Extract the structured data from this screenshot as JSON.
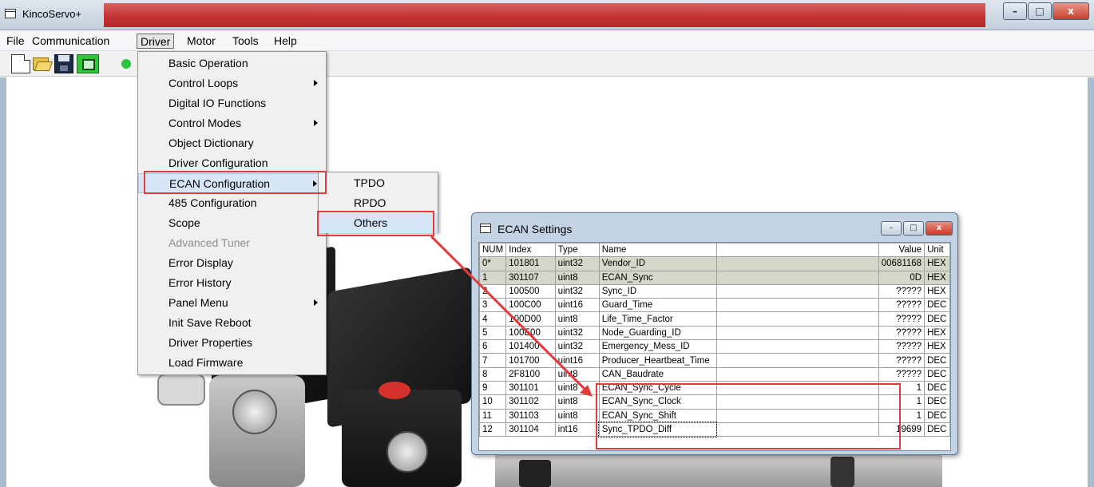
{
  "window": {
    "title": "KincoServo+"
  },
  "menubar": [
    "File",
    "Communication",
    "Driver",
    "Motor",
    "Tools",
    "Help"
  ],
  "driver_menu": [
    {
      "label": "Basic Operation"
    },
    {
      "label": "Control Loops",
      "submenu": true
    },
    {
      "label": "Digital IO Functions"
    },
    {
      "label": "Control Modes",
      "submenu": true
    },
    {
      "label": "Object Dictionary"
    },
    {
      "label": "Driver Configuration"
    },
    {
      "label": "ECAN Configuration",
      "submenu": true
    },
    {
      "label": "485 Configuration"
    },
    {
      "label": "Scope"
    },
    {
      "label": "Advanced Tuner",
      "disabled": true
    },
    {
      "label": "Error Display"
    },
    {
      "label": "Error History"
    },
    {
      "label": "Panel Menu",
      "submenu": true
    },
    {
      "label": "Init Save Reboot"
    },
    {
      "label": "Driver Properties"
    },
    {
      "label": "Load Firmware"
    }
  ],
  "ecan_submenu": [
    "TPDO",
    "RPDO",
    "Others"
  ],
  "dialog": {
    "title": "ECAN Settings",
    "columns": [
      "NUM",
      "Index",
      "Type",
      "Name",
      "",
      "Value",
      "Unit"
    ],
    "rows": [
      {
        "num": "0*",
        "index": "101801",
        "type": "uint32",
        "name": "Vendor_ID",
        "value": "00681168",
        "unit": "HEX"
      },
      {
        "num": "1",
        "index": "301107",
        "type": "uint8",
        "name": "ECAN_Sync",
        "value": "0D",
        "unit": "HEX"
      },
      {
        "num": "2",
        "index": "100500",
        "type": "uint32",
        "name": "Sync_ID",
        "value": "?????",
        "unit": "HEX"
      },
      {
        "num": "3",
        "index": "100C00",
        "type": "uint16",
        "name": "Guard_Time",
        "value": "?????",
        "unit": "DEC"
      },
      {
        "num": "4",
        "index": "100D00",
        "type": "uint8",
        "name": "Life_Time_Factor",
        "value": "?????",
        "unit": "DEC"
      },
      {
        "num": "5",
        "index": "100E00",
        "type": "uint32",
        "name": "Node_Guarding_ID",
        "value": "?????",
        "unit": "HEX"
      },
      {
        "num": "6",
        "index": "101400",
        "type": "uint32",
        "name": "Emergency_Mess_ID",
        "value": "?????",
        "unit": "HEX"
      },
      {
        "num": "7",
        "index": "101700",
        "type": "uint16",
        "name": "Producer_Heartbeat_Time",
        "value": "?????",
        "unit": "DEC"
      },
      {
        "num": "8",
        "index": "2F8100",
        "type": "uint8",
        "name": "CAN_Baudrate",
        "value": "?????",
        "unit": "DEC"
      },
      {
        "num": "9",
        "index": "301101",
        "type": "uint8",
        "name": "ECAN_Sync_Cycle",
        "value": "1",
        "unit": "DEC"
      },
      {
        "num": "10",
        "index": "301102",
        "type": "uint8",
        "name": "ECAN_Sync_Clock",
        "value": "1",
        "unit": "DEC"
      },
      {
        "num": "11",
        "index": "301103",
        "type": "uint8",
        "name": "ECAN_Sync_Shift",
        "value": "1",
        "unit": "DEC"
      },
      {
        "num": "12",
        "index": "301104",
        "type": "int16",
        "name": "Sync_TPDO_Diff",
        "value": "19699",
        "unit": "DEC"
      }
    ]
  },
  "colors": {
    "highlight_box": "#e33b3b",
    "title_bar_accent": "#c12727"
  },
  "icons": [
    "app-icon",
    "new-file-icon",
    "open-folder-icon",
    "save-icon",
    "connect-icon",
    "status-dot-icon",
    "minimize-icon",
    "maximize-icon",
    "close-icon"
  ]
}
